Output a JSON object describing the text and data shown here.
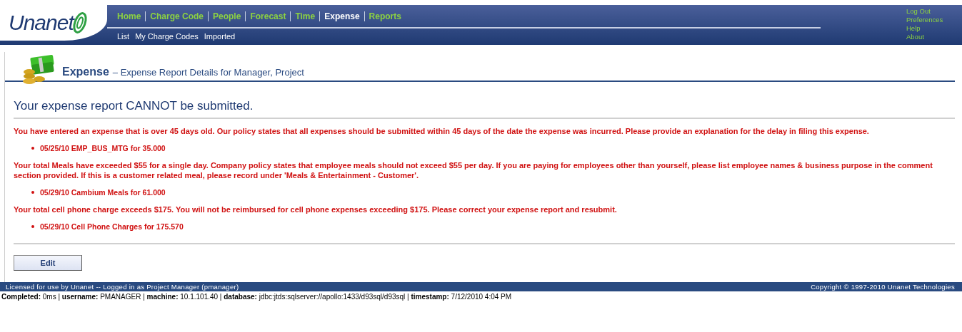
{
  "logo": {
    "text": "Unanet"
  },
  "main_nav": [
    {
      "label": "Home",
      "selected": false
    },
    {
      "label": "Charge Code",
      "selected": false
    },
    {
      "label": "People",
      "selected": false
    },
    {
      "label": "Forecast",
      "selected": false
    },
    {
      "label": "Time",
      "selected": false
    },
    {
      "label": "Expense",
      "selected": true
    },
    {
      "label": "Reports",
      "selected": false
    }
  ],
  "sub_nav": [
    "List",
    "My Charge Codes",
    "Imported"
  ],
  "utility_links": [
    "Log Out",
    "Preferences",
    "Help",
    "About"
  ],
  "page_title": {
    "module": "Expense",
    "subtitle": "– Expense Report Details for Manager, Project"
  },
  "heading": "Your expense report CANNOT be submitted.",
  "violations": [
    {
      "message": "You have entered an expense that is over 45 days old. Our policy states that all expenses should be submitted within 45 days of the date the expense was incurred. Please provide an explanation for the delay in filing this expense.",
      "items": [
        "05/25/10 EMP_BUS_MTG for 35.000"
      ]
    },
    {
      "message": "Your total Meals have exceeded $55 for a single day. Company policy states that employee meals should not exceed $55 per day. If you are paying for employees other than yourself, please list employee names & business purpose in the comment section provided. If this is a customer related meal, please record under 'Meals & Entertainment - Customer'.",
      "items": [
        "05/29/10 Cambium Meals for 61.000"
      ]
    },
    {
      "message": "Your total cell phone charge exceeds $175. You will not be reimbursed for cell phone expenses exceeding $175. Please correct your expense report and resubmit.",
      "items": [
        "05/29/10 Cell Phone Charges for 175.570"
      ]
    }
  ],
  "buttons": [
    "Edit"
  ],
  "footer": {
    "license": "Licensed for use by Unanet -- Logged in as Project Manager (pmanager)",
    "copyright": "Copyright © 1997-2010 Unanet Technologies"
  },
  "status_line": "**Completed:** 0ms | **username:** PMANAGER | **machine:** 10.1.101.40 | **database:** jdbc:jtds:sqlserver://apollo:1433/d93sql/d93sql | **timestamp:** 7/12/2010 4:04 PM"
}
